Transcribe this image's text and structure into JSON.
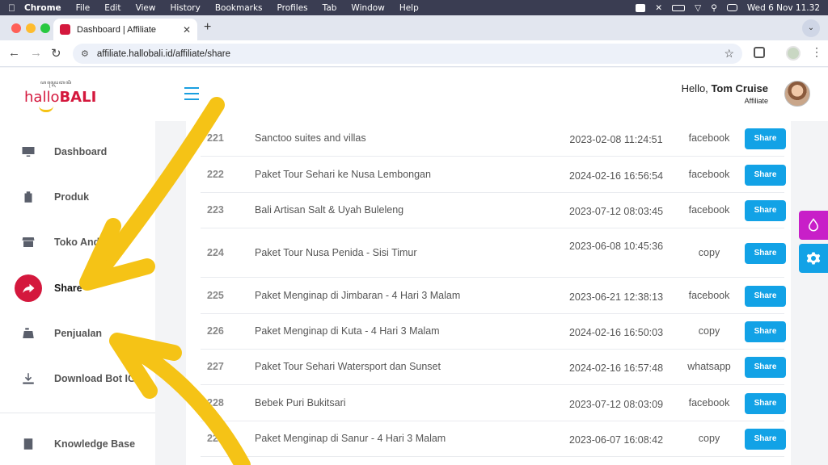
{
  "menubar": {
    "app": "Chrome",
    "items": [
      "File",
      "Edit",
      "View",
      "History",
      "Bookmarks",
      "Profiles",
      "Tab",
      "Window",
      "Help"
    ],
    "clock": "Wed 6 Nov  11.32"
  },
  "browser": {
    "tab_title": "Dashboard | Affiliate",
    "url": "affiliate.hallobali.id/affiliate/share"
  },
  "logo": {
    "tagline": "ꦲꦭ꧀ꦭꦺꦴꦧꦭꦶ",
    "hallo": "hallo",
    "bali": "BALI"
  },
  "sidebar": {
    "items": [
      {
        "label": "Dashboard",
        "icon": "monitor-icon"
      },
      {
        "label": "Produk",
        "icon": "bag-icon"
      },
      {
        "label": "Toko Anda",
        "icon": "store-icon"
      },
      {
        "label": "Share",
        "icon": "share-icon",
        "active": true
      },
      {
        "label": "Penjualan",
        "icon": "cash-register-icon"
      },
      {
        "label": "Download Bot IG",
        "icon": "download-icon"
      }
    ],
    "knowledge": "Knowledge Base"
  },
  "header": {
    "hello": "Hello,",
    "user_name": "Tom Cruise",
    "role": "Affiliate"
  },
  "table": {
    "button_label": "Share",
    "rows": [
      {
        "id": "221",
        "name": "Sanctoo suites and villas",
        "date": "2023-02-08 11:24:51",
        "source": "facebook"
      },
      {
        "id": "222",
        "name": "Paket Tour Sehari ke Nusa Lembongan",
        "date": "2024-02-16 16:56:54",
        "source": "facebook"
      },
      {
        "id": "223",
        "name": "Bali Artisan Salt & Uyah Buleleng",
        "date": "2023-07-12 08:03:45",
        "source": "facebook"
      },
      {
        "id": "224",
        "name": "Paket Tour Nusa Penida - Sisi Timur",
        "date": "2023-06-08 10:45:36",
        "source": "copy"
      },
      {
        "id": "225",
        "name": "Paket Menginap di Jimbaran - 4 Hari 3 Malam",
        "date": "2023-06-21 12:38:13",
        "source": "facebook"
      },
      {
        "id": "226",
        "name": "Paket Menginap di Kuta - 4 Hari 3 Malam",
        "date": "2024-02-16 16:50:03",
        "source": "copy"
      },
      {
        "id": "227",
        "name": "Paket Tour Sehari Watersport dan Sunset",
        "date": "2024-02-16 16:57:48",
        "source": "whatsapp"
      },
      {
        "id": "228",
        "name": "Bebek Puri Bukitsari",
        "date": "2023-07-12 08:03:09",
        "source": "facebook"
      },
      {
        "id": "229",
        "name": "Paket Menginap di Sanur - 4 Hari 3 Malam",
        "date": "2023-06-07 16:08:42",
        "source": "copy"
      }
    ]
  },
  "colors": {
    "brand": "#d4183d",
    "accent": "#12a2e6",
    "highlight": "#f5c316",
    "theme_btn": "#c81fc8"
  }
}
